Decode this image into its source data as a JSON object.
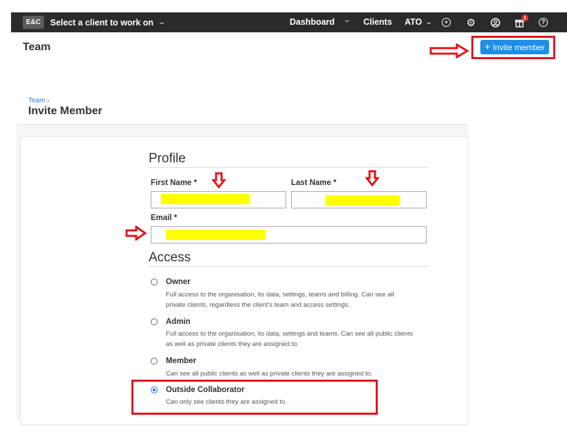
{
  "topbar": {
    "logo": "E&C",
    "client_select": "Select a client to work on",
    "nav": {
      "dashboard": "Dashboard",
      "clients": "Clients",
      "ato": "ATO"
    },
    "gift_badge": "1"
  },
  "page": {
    "title": "Team",
    "invite_button": "Invite member"
  },
  "breadcrumb": {
    "parent": "Team ›"
  },
  "form": {
    "title": "Invite Member",
    "profile_heading": "Profile",
    "first_name_label": "First Name *",
    "last_name_label": "Last Name *",
    "email_label": "Email *",
    "access_heading": "Access",
    "options": [
      {
        "label": "Owner",
        "description": "Full access to the organisation, its data, settings, teams and billing. Can see all private clients, regardless the client's team and access settings.",
        "selected": false
      },
      {
        "label": "Admin",
        "description": "Full access to the organisation, its data, settings and teams. Can see all public clients as well as private clients they are assigned to.",
        "selected": false
      },
      {
        "label": "Member",
        "description": "Can see all public clients as well as private clients they are assigned to.",
        "selected": false
      },
      {
        "label": "Outside Collaborator",
        "description": "Can only see clients they are assigned to.",
        "selected": true
      }
    ]
  },
  "colors": {
    "topbar_bg": "#2b2b2b",
    "accent_blue": "#1e8ee6",
    "annotation_red": "#e0151d",
    "redaction_yellow": "#ffff00"
  },
  "icons": [
    "chevron-down-icon",
    "plus-circle-icon",
    "gear-icon",
    "user-circle-icon",
    "gift-icon",
    "help-circle-icon",
    "plus-icon"
  ]
}
